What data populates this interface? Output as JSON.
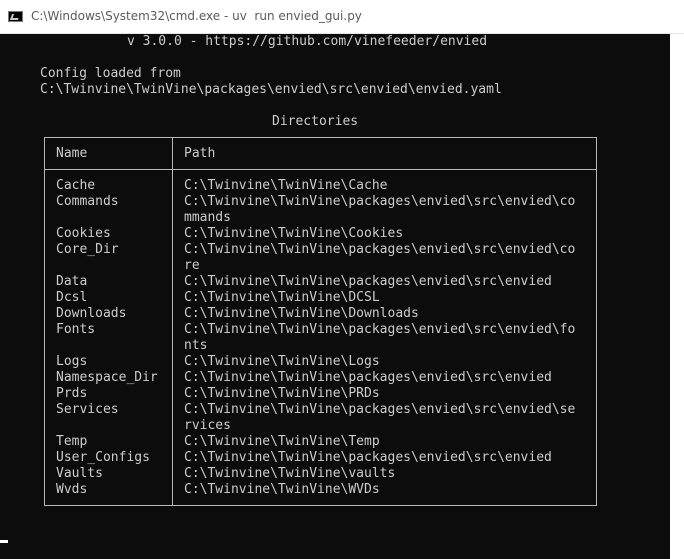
{
  "window": {
    "title": "C:\\Windows\\System32\\cmd.exe - uv  run envied_gui.py",
    "icon": "cmd-icon"
  },
  "console": {
    "version_line": "v 3.0.0 - https://github.com/vinefeeder/envied",
    "config_line1": "Config loaded from",
    "config_line2": "C:\\Twinvine\\TwinVine\\packages\\envied\\src\\envied\\envied.yaml",
    "table_title": "Directories",
    "headers": {
      "name": "Name",
      "path": "Path"
    },
    "rows": [
      {
        "name": "Cache",
        "path": [
          "C:\\Twinvine\\TwinVine\\Cache"
        ]
      },
      {
        "name": "Commands",
        "path": [
          "C:\\Twinvine\\TwinVine\\packages\\envied\\src\\envied\\co",
          "mmands"
        ]
      },
      {
        "name": "Cookies",
        "path": [
          "C:\\Twinvine\\TwinVine\\Cookies"
        ]
      },
      {
        "name": "Core_Dir",
        "path": [
          "C:\\Twinvine\\TwinVine\\packages\\envied\\src\\envied\\co",
          "re"
        ]
      },
      {
        "name": "Data",
        "path": [
          "C:\\Twinvine\\TwinVine\\packages\\envied\\src\\envied"
        ]
      },
      {
        "name": "Dcsl",
        "path": [
          "C:\\Twinvine\\TwinVine\\DCSL"
        ]
      },
      {
        "name": "Downloads",
        "path": [
          "C:\\Twinvine\\TwinVine\\Downloads"
        ]
      },
      {
        "name": "Fonts",
        "path": [
          "C:\\Twinvine\\TwinVine\\packages\\envied\\src\\envied\\fo",
          "nts"
        ]
      },
      {
        "name": "Logs",
        "path": [
          "C:\\Twinvine\\TwinVine\\Logs"
        ]
      },
      {
        "name": "Namespace_Dir",
        "path": [
          "C:\\Twinvine\\TwinVine\\packages\\envied\\src\\envied"
        ]
      },
      {
        "name": "Prds",
        "path": [
          "C:\\Twinvine\\TwinVine\\PRDs"
        ]
      },
      {
        "name": "Services",
        "path": [
          "C:\\Twinvine\\TwinVine\\packages\\envied\\src\\envied\\se",
          "rvices"
        ]
      },
      {
        "name": "Temp",
        "path": [
          "C:\\Twinvine\\TwinVine\\Temp"
        ]
      },
      {
        "name": "User_Configs",
        "path": [
          "C:\\Twinvine\\TwinVine\\packages\\envied\\src\\envied"
        ]
      },
      {
        "name": "Vaults",
        "path": [
          "C:\\Twinvine\\TwinVine\\vaults"
        ]
      },
      {
        "name": "Wvds",
        "path": [
          "C:\\Twinvine\\TwinVine\\WVDs"
        ]
      }
    ]
  },
  "colors": {
    "console_bg": "#0c0c0c",
    "console_fg": "#cccccc",
    "table_border": "#b8b8b8"
  }
}
